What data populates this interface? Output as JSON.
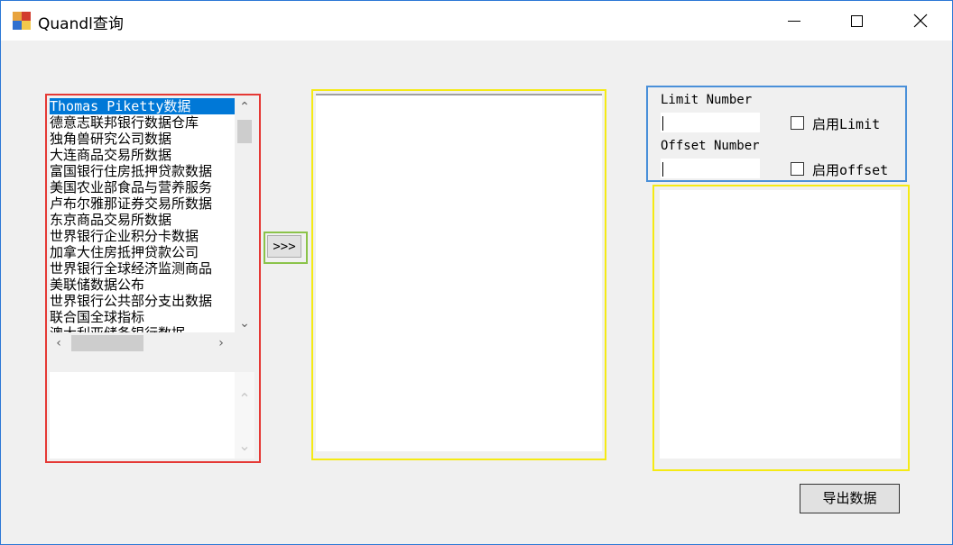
{
  "window": {
    "title": "Quandl查询"
  },
  "source_list": {
    "items": [
      "Thomas Piketty数据",
      "德意志联邦银行数据仓库",
      "独角兽研究公司数据",
      "大连商品交易所数据",
      "富国银行住房抵押贷款数据",
      "美国农业部食品与营养服务",
      "卢布尔雅那证券交易所数据",
      "东京商品交易所数据",
      "世界银行企业积分卡数据",
      "加拿大住房抵押贷款公司",
      "世界银行全球经济监测商品",
      "美联储数据公布",
      "世界银行公共部分支出数据",
      "联合国全球指标",
      "澳大利亚储备银行数据"
    ],
    "selected_index": 0
  },
  "transfer_button": {
    "label": ">>>"
  },
  "options": {
    "limit_label": "Limit Number",
    "limit_value": "",
    "enable_limit_label": "启用Limit",
    "offset_label": "Offset Number",
    "offset_value": "",
    "enable_offset_label": "启用offset"
  },
  "export_button": {
    "label": "导出数据"
  }
}
